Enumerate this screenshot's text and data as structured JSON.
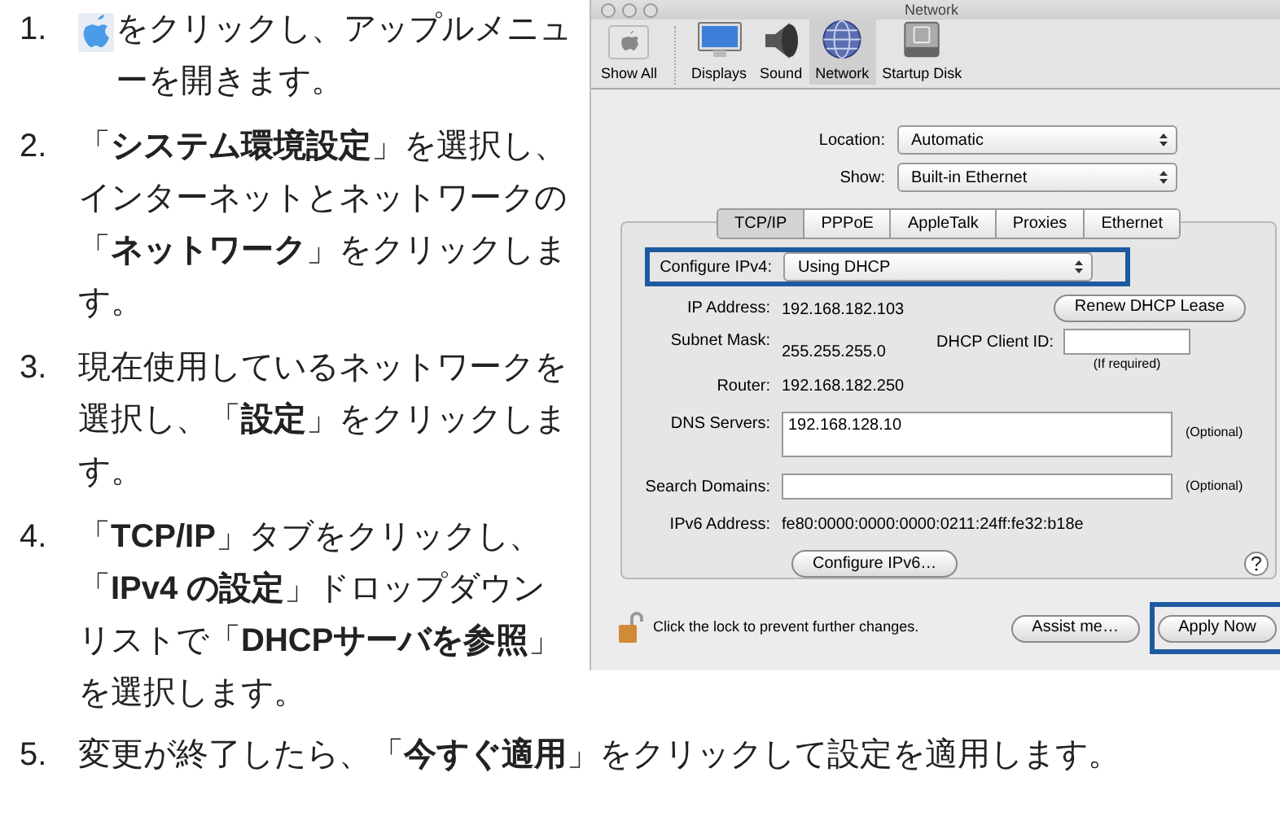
{
  "steps": [
    {
      "number": "1.",
      "kind": "apple_icon_text",
      "text": "をクリックし、アップルメニューを開きます。"
    },
    {
      "number": "2.",
      "kind": "text",
      "text": "「**システム環境設定**」を選択し、インターネットとネットワークの「**ネットワーク**」をクリックします。"
    },
    {
      "number": "3.",
      "kind": "text",
      "text": "現在使用しているネットワークを選択し、「**設定**」をクリックします。"
    },
    {
      "number": "4.",
      "kind": "text",
      "text": "「**TCP/IP**」タブをクリックし、「**IPv4 の設定**」ドロップダウンリストで「**DHCPサーバを参照**」を選択します。"
    },
    {
      "number": "5.",
      "kind": "text",
      "text": "変更が終了したら、「**今すぐ適用**」をクリックして設定を適用します。"
    }
  ],
  "window": {
    "title": "Network",
    "toolbar": [
      {
        "label": "Show All",
        "kind": "show_all",
        "selected": false
      },
      {
        "label": "Displays",
        "kind": "displays",
        "selected": false
      },
      {
        "label": "Sound",
        "kind": "sound",
        "selected": false
      },
      {
        "label": "Network",
        "kind": "network",
        "selected": true
      },
      {
        "label": "Startup Disk",
        "kind": "disk",
        "selected": false
      }
    ],
    "location": {
      "label": "Location:",
      "value": "Automatic"
    },
    "show": {
      "label": "Show:",
      "value": "Built-in Ethernet"
    },
    "tabs": [
      {
        "label": "TCP/IP",
        "selected": true
      },
      {
        "label": "PPPoE",
        "selected": false
      },
      {
        "label": "AppleTalk",
        "selected": false
      },
      {
        "label": "Proxies",
        "selected": false
      },
      {
        "label": "Ethernet",
        "selected": false
      }
    ],
    "configure_ipv4": {
      "label": "Configure IPv4:",
      "value": "Using DHCP",
      "highlighted": true
    },
    "ip_address": {
      "label": "IP Address:",
      "value": "192.168.182.103"
    },
    "renew_button": "Renew DHCP Lease",
    "subnet_mask": {
      "label": "Subnet Mask:",
      "value": "255.255.255.0"
    },
    "dhcp_client_id": {
      "label": "DHCP Client ID:",
      "hint": "(If required)"
    },
    "router": {
      "label": "Router:",
      "value": "192.168.182.250"
    },
    "dns_servers": {
      "label": "DNS Servers:",
      "value": "192.168.128.10",
      "note": "(Optional)"
    },
    "search_domains": {
      "label": "Search Domains:",
      "note": "(Optional)"
    },
    "ipv6_address": {
      "label": "IPv6 Address:",
      "value": "fe80:0000:0000:0000:0211:24ff:fe32:b18e"
    },
    "configure_ipv6_button": "Configure IPv6…",
    "lock_message": "Click the lock to prevent further changes.",
    "assist_button": "Assist me…",
    "apply_button": {
      "label": "Apply Now",
      "highlighted": true
    }
  }
}
